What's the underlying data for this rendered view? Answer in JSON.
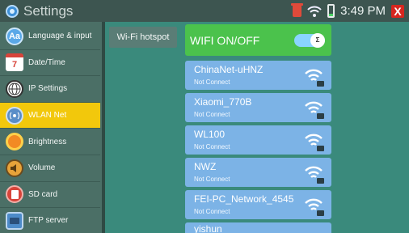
{
  "statusbar": {
    "title": "Settings",
    "time": "3:49 PM",
    "close_glyph": "X"
  },
  "sidebar": {
    "items": [
      {
        "label": "Language & input",
        "icon": "Aa"
      },
      {
        "label": "Date/Time",
        "icon": "7"
      },
      {
        "label": "IP Settings",
        "icon": ""
      },
      {
        "label": "WLAN Net",
        "icon": ""
      },
      {
        "label": "Brightness",
        "icon": ""
      },
      {
        "label": "Volume",
        "icon": ""
      },
      {
        "label": "SD card",
        "icon": ""
      },
      {
        "label": "FTP server",
        "icon": ""
      }
    ]
  },
  "hotspot": {
    "label": "Wi-Fi hotspot"
  },
  "wifi_toggle": {
    "label": "WIFI ON/OFF",
    "switch_glyph": "Σ"
  },
  "networks": [
    {
      "name": "ChinaNet-uHNZ",
      "status": "Not Connect"
    },
    {
      "name": "Xiaomi_770B",
      "status": "Not Connect"
    },
    {
      "name": "WL100",
      "status": "Not Connect"
    },
    {
      "name": "NWZ",
      "status": "Not Connect"
    },
    {
      "name": "FEI-PC_Network_4545",
      "status": "Not Connect"
    },
    {
      "name": "yishun",
      "status": ""
    }
  ],
  "colors": {
    "active_item": "#f2c80c",
    "toggle_on": "#4bc24c",
    "network_card": "#7cb3e6",
    "close": "#d7261f"
  }
}
